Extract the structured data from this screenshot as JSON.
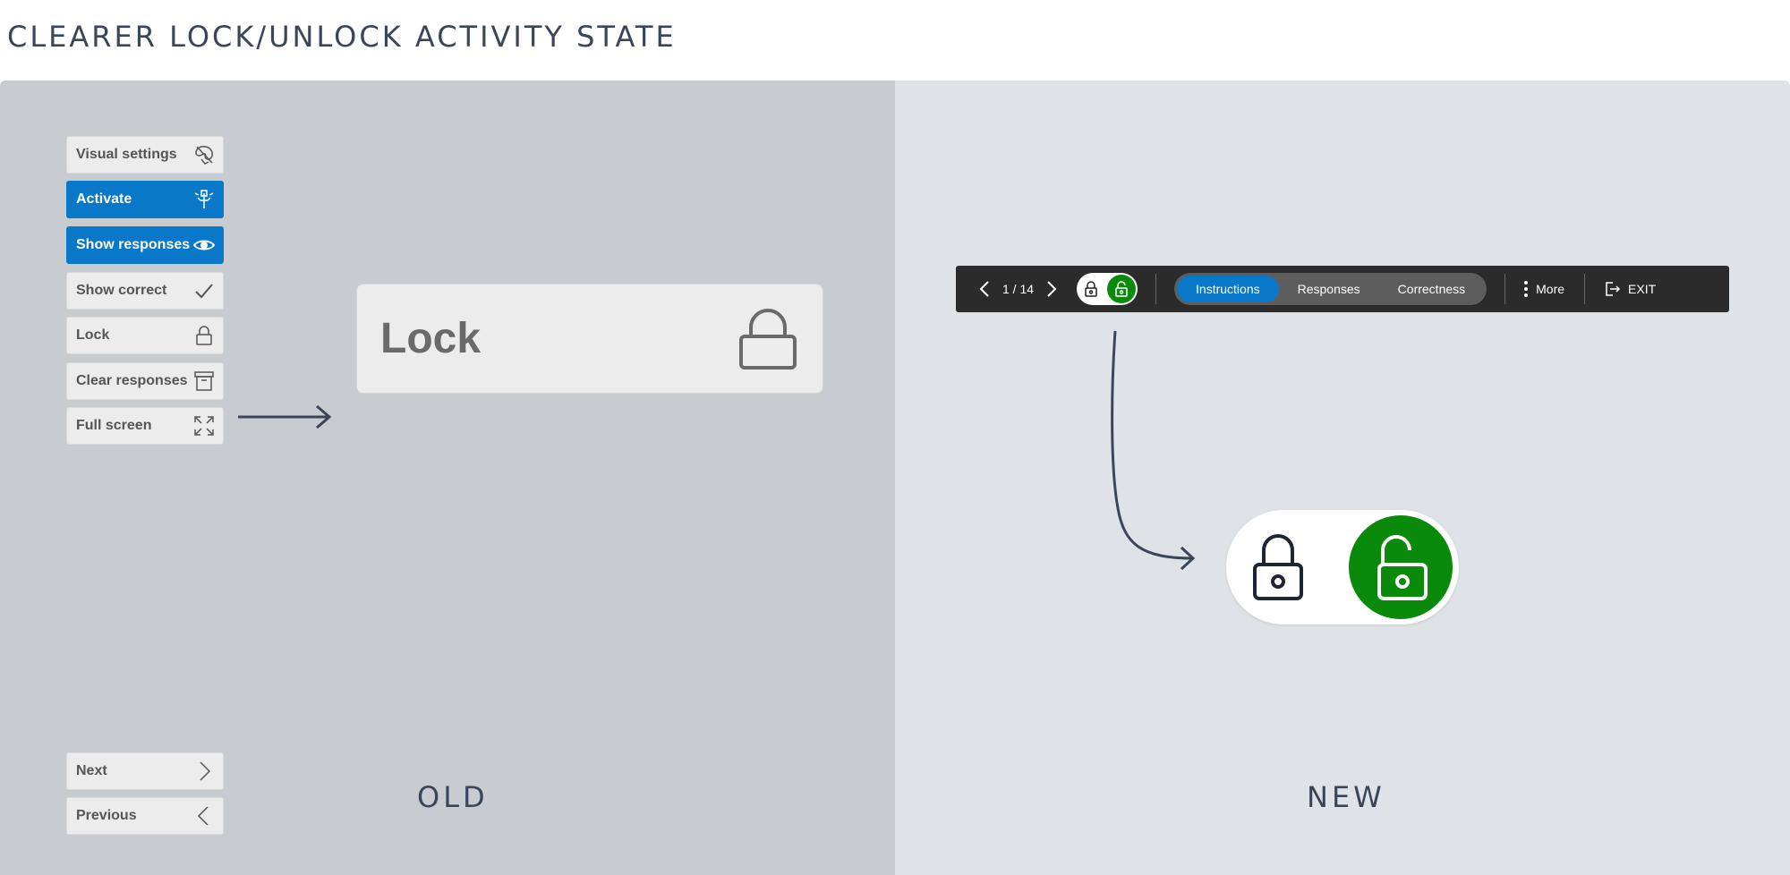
{
  "page": {
    "title": "CLEARER LOCK/UNLOCK ACTIVITY STATE"
  },
  "old": {
    "label": "OLD",
    "sidebar": [
      {
        "label": "Visual settings",
        "icon": "visual-settings-icon",
        "active": false
      },
      {
        "label": "Activate",
        "icon": "activate-icon",
        "active": true
      },
      {
        "label": "Show responses",
        "icon": "eye-icon",
        "active": true
      },
      {
        "label": "Show correct",
        "icon": "checkmark-icon",
        "active": false
      },
      {
        "label": "Lock",
        "icon": "lock-icon",
        "active": false
      },
      {
        "label": "Clear responses",
        "icon": "archive-icon",
        "active": false
      },
      {
        "label": "Full screen",
        "icon": "fullscreen-icon",
        "active": false
      }
    ],
    "bottom_nav": [
      {
        "label": "Next",
        "icon": "chevron-right-icon"
      },
      {
        "label": "Previous",
        "icon": "chevron-left-icon"
      }
    ],
    "zoom_label": "Lock",
    "colors": {
      "active": "#0a78c8",
      "panel": "#c8cbd0"
    }
  },
  "new": {
    "label": "NEW",
    "toolbar": {
      "page_indicator": "1 / 14",
      "tabs": [
        "Instructions",
        "Responses",
        "Correctness"
      ],
      "selected_tab": "Instructions",
      "more_label": "More",
      "exit_label": "EXIT"
    },
    "colors": {
      "unlock": "#0a8a0a",
      "selected_tab": "#0a78c8",
      "toolbar": "#2b2b2b",
      "panel": "#dfe2e7"
    }
  }
}
